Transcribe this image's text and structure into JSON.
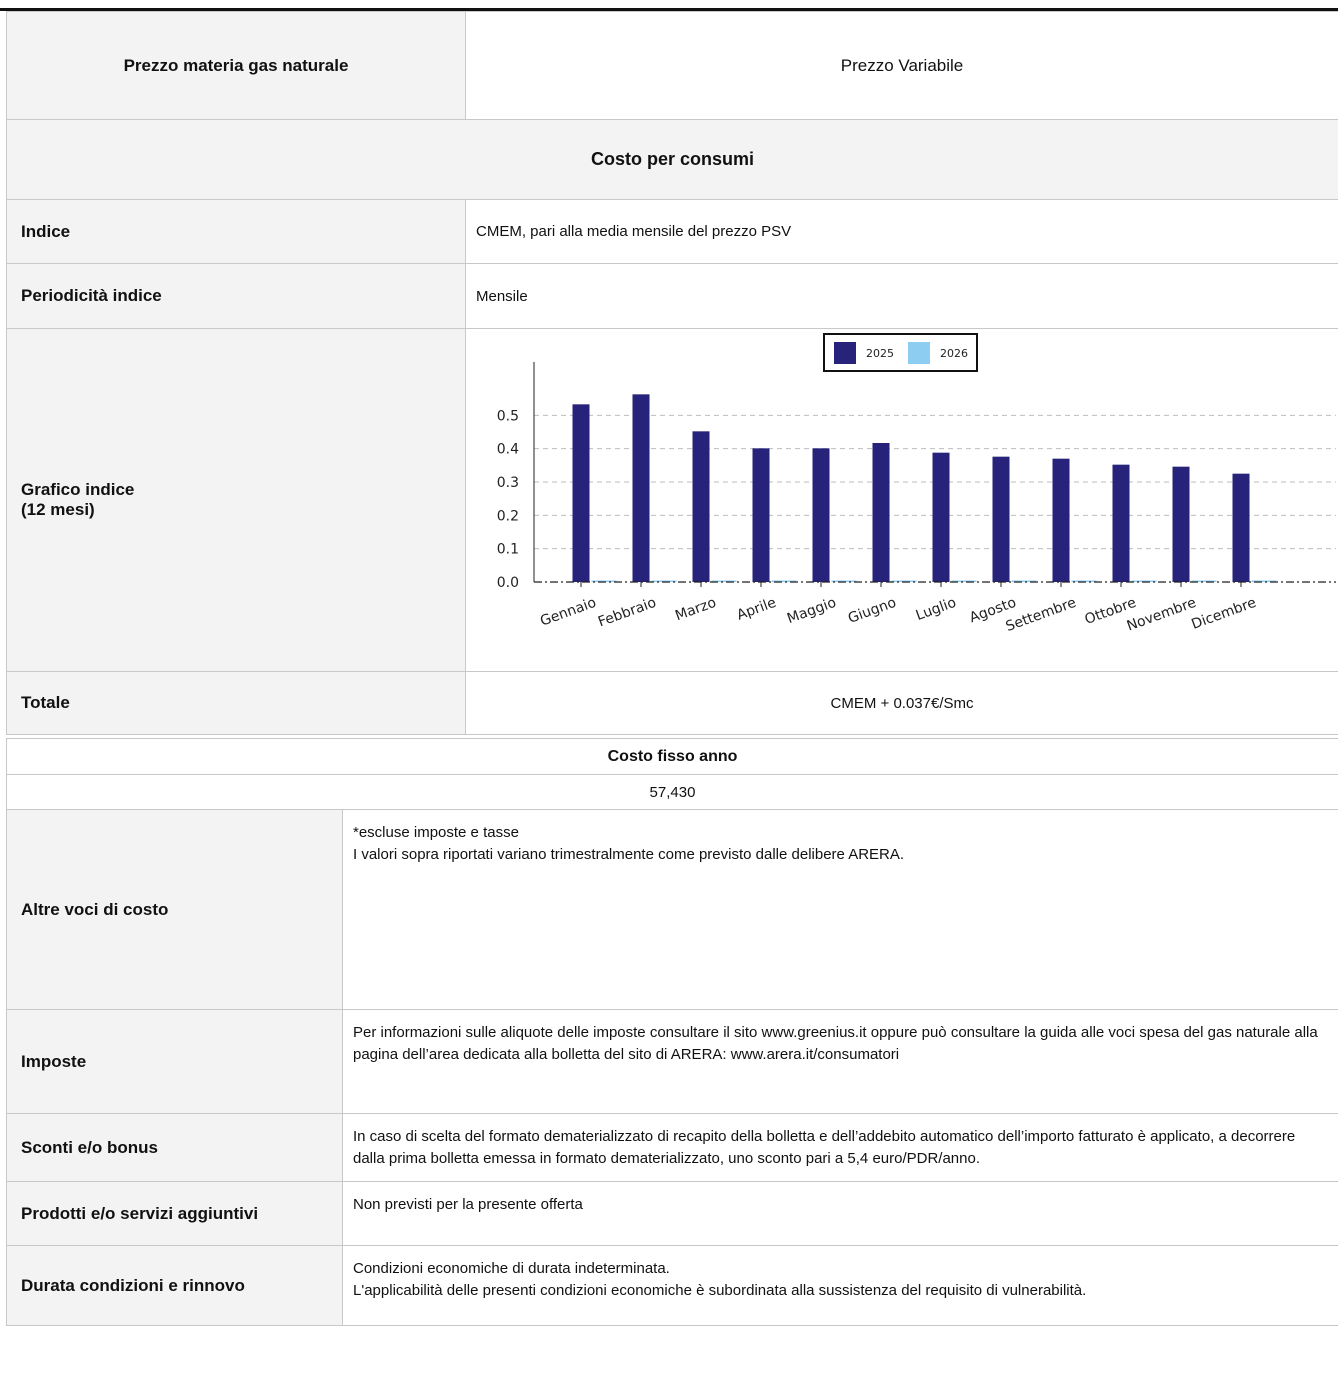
{
  "materia": {
    "label": "Prezzo materia gas naturale",
    "value": "Prezzo Variabile"
  },
  "consumi": {
    "header": "Costo per consumi",
    "indice_label": "Indice",
    "indice_value": "CMEM, pari alla media mensile del prezzo PSV",
    "periodicita_label": "Periodicità indice",
    "periodicita_value": "Mensile",
    "grafico_label_1": "Grafico indice",
    "grafico_label_2": "(12 mesi)",
    "totale_label": "Totale",
    "totale_value": "CMEM + 0.037€/Smc"
  },
  "chart_data": {
    "type": "bar",
    "categories": [
      "Gennaio",
      "Febbraio",
      "Marzo",
      "Aprile",
      "Maggio",
      "Giugno",
      "Luglio",
      "Agosto",
      "Settembre",
      "Ottobre",
      "Novembre",
      "Dicembre"
    ],
    "series": [
      {
        "name": "2025",
        "values": [
          0.533,
          0.563,
          0.452,
          0.401,
          0.401,
          0.417,
          0.388,
          0.376,
          0.37,
          0.352,
          0.346,
          0.325
        ]
      },
      {
        "name": "2026",
        "values": [
          0,
          0,
          0,
          0,
          0,
          0,
          0,
          0,
          0,
          0,
          0,
          0
        ]
      }
    ],
    "yticks": [
      "0.0",
      "0.1",
      "0.2",
      "0.3",
      "0.4",
      "0.5"
    ],
    "ylim": [
      0,
      0.6
    ],
    "grid": true,
    "legend": "top-center",
    "colors": [
      "#27237a",
      "#8ecdf2"
    ]
  },
  "fisso": {
    "header": "Costo fisso anno",
    "value": "57,430"
  },
  "altre": {
    "label": "Altre voci di costo",
    "line1": "*escluse imposte e tasse",
    "line2": "I valori sopra riportati variano trimestralmente come previsto dalle delibere ARERA."
  },
  "imposte": {
    "label": "Imposte",
    "text": "Per informazioni sulle aliquote delle imposte consultare il sito www.greenius.it oppure può consultare la guida alle voci spesa del gas naturale alla pagina dell’area dedicata alla bolletta del sito di ARERA: www.arera.it/consumatori"
  },
  "sconti": {
    "label": "Sconti e/o bonus",
    "text": "In caso di scelta del formato dematerializzato di recapito della bolletta e dell’addebito automatico dell’importo fatturato è applicato, a decorrere dalla prima bolletta emessa in formato dematerializzato, uno sconto pari a 5,4 euro/PDR/anno."
  },
  "prodotti": {
    "label": "Prodotti e/o servizi aggiuntivi",
    "text": "Non previsti per la presente offerta"
  },
  "durata": {
    "label": "Durata condizioni e rinnovo",
    "line1": "Condizioni economiche di durata indeterminata.",
    "line2": "L'applicabilità delle presenti condizioni economiche è subordinata alla sussistenza del requisito di vulnerabilità."
  }
}
